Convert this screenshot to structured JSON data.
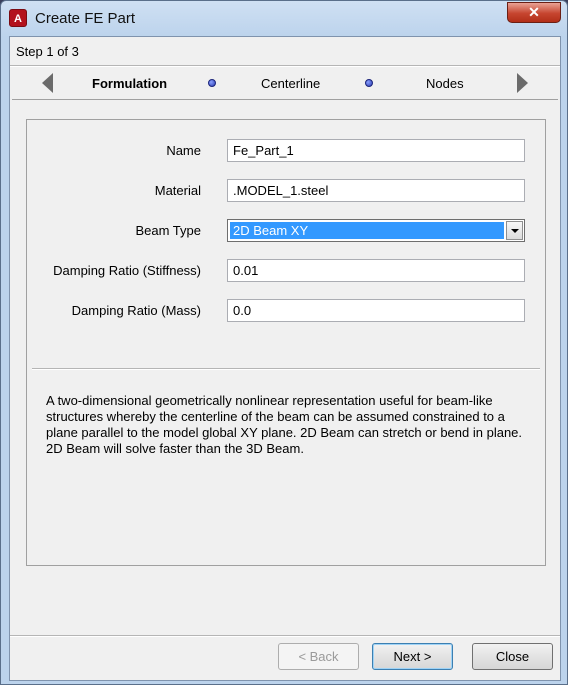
{
  "window": {
    "app_icon_letter": "A",
    "title": "Create FE Part",
    "close_glyph": "✕"
  },
  "wizard": {
    "step_text": "Step 1 of 3",
    "steps": [
      {
        "label": "Formulation",
        "active": true
      },
      {
        "label": "Centerline",
        "active": false
      },
      {
        "label": "Nodes",
        "active": false
      }
    ]
  },
  "form": {
    "name_label": "Name",
    "name_value": "Fe_Part_1",
    "material_label": "Material",
    "material_value": ".MODEL_1.steel",
    "beam_type_label": "Beam Type",
    "beam_type_value": "2D Beam XY",
    "damping_stiffness_label": "Damping Ratio (Stiffness)",
    "damping_stiffness_value": "0.01",
    "damping_mass_label": "Damping Ratio (Mass)",
    "damping_mass_value": "0.0"
  },
  "description": "A two-dimensional geometrically nonlinear representation useful for beam-like structures whereby the centerline of the beam can be assumed constrained to a plane parallel to the model global XY plane. 2D Beam can stretch or bend in plane. 2D Beam will solve faster than the 3D Beam.",
  "buttons": {
    "back": "< Back",
    "next": "Next >",
    "close": "Close"
  },
  "colors": {
    "selection": "#3399ff",
    "step_dot": "#2a3bb0",
    "app_icon": "#b3121d"
  }
}
